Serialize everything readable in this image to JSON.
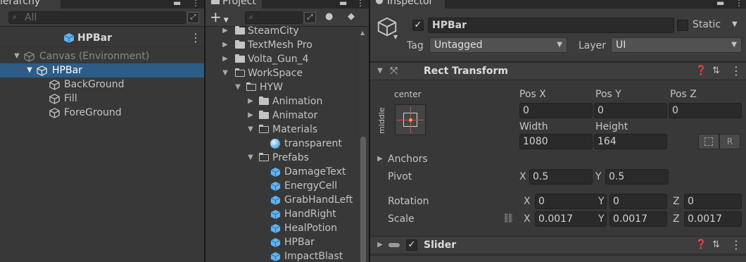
{
  "hierarchy": {
    "tab_label": "ierarchy",
    "search_placeholder": "All",
    "scene_title": "HPBar",
    "items": [
      {
        "label": "Canvas (Environment)"
      },
      {
        "label": "HPBar"
      },
      {
        "label": "BackGround"
      },
      {
        "label": "Fill"
      },
      {
        "label": "ForeGround"
      }
    ]
  },
  "project": {
    "tab_label": "Project",
    "add_label": "+",
    "items": [
      {
        "label": "SteamCity",
        "kind": "folder"
      },
      {
        "label": "TextMesh Pro",
        "kind": "folder"
      },
      {
        "label": "Volta_Gun_4",
        "kind": "folder"
      },
      {
        "label": "WorkSpace",
        "kind": "folder-open"
      },
      {
        "label": "HYW",
        "kind": "folder-open"
      },
      {
        "label": "Animation",
        "kind": "folder"
      },
      {
        "label": "Animator",
        "kind": "folder"
      },
      {
        "label": "Materials",
        "kind": "folder-open"
      },
      {
        "label": "transparent",
        "kind": "material"
      },
      {
        "label": "Prefabs",
        "kind": "folder-open"
      },
      {
        "label": "DamageText",
        "kind": "prefab"
      },
      {
        "label": "EnergyCell",
        "kind": "prefab"
      },
      {
        "label": "GrabHandLeft",
        "kind": "prefab"
      },
      {
        "label": "HandRight",
        "kind": "prefab"
      },
      {
        "label": "HealPotion",
        "kind": "prefab"
      },
      {
        "label": "HPBar",
        "kind": "prefab"
      },
      {
        "label": "ImpactBlast",
        "kind": "prefab"
      }
    ]
  },
  "inspector": {
    "tab_label": "Inspector",
    "object_name": "HPBar",
    "static_label": "Static",
    "tag_label": "Tag",
    "tag_value": "Untagged",
    "layer_label": "Layer",
    "layer_value": "UI",
    "rect_transform": {
      "title": "Rect Transform",
      "anchor_h": "center",
      "anchor_v": "middle",
      "pos_x_label": "Pos X",
      "pos_y_label": "Pos Y",
      "pos_z_label": "Pos Z",
      "pos_x": "0",
      "pos_y": "0",
      "pos_z": "0",
      "width_label": "Width",
      "height_label": "Height",
      "width": "1080",
      "height": "164",
      "raw_btn": "R",
      "anchors_label": "Anchors",
      "pivot_label": "Pivot",
      "pivot_x_label": "X",
      "pivot_y_label": "Y",
      "pivot_x": "0.5",
      "pivot_y": "0.5",
      "rotation_label": "Rotation",
      "rot_x_label": "X",
      "rot_y_label": "Y",
      "rot_z_label": "Z",
      "rot_x": "0",
      "rot_y": "0",
      "rot_z": "0",
      "scale_label": "Scale",
      "scale_x_label": "X",
      "scale_y_label": "Y",
      "scale_z_label": "Z",
      "scale_x": "0.0017",
      "scale_y": "0.0017",
      "scale_z": "0.0017"
    },
    "slider": {
      "title": "Slider"
    }
  },
  "colors": {
    "selection": "#2c5d87",
    "prefab_blue": "#5fb3f0",
    "panel_bg": "#383838",
    "field_bg": "#2a2a2a"
  }
}
